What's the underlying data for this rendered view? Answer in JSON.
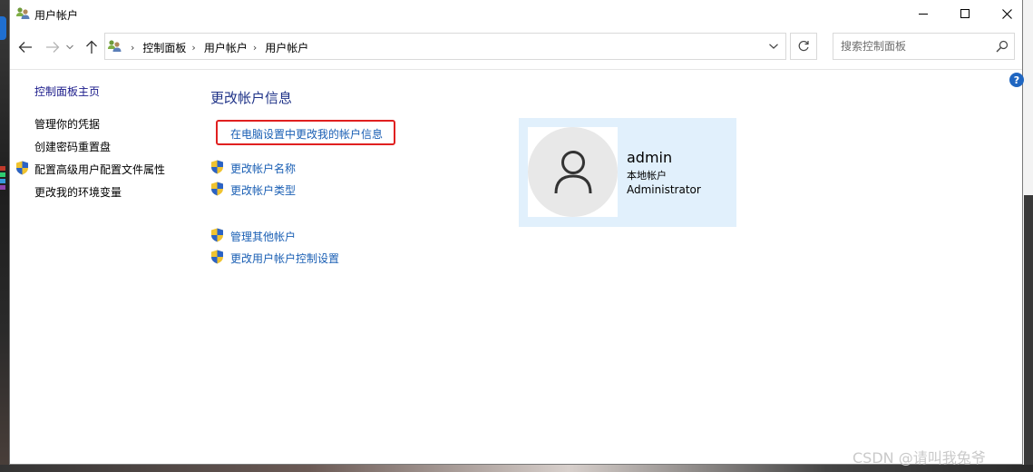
{
  "window": {
    "title": "用户帐户"
  },
  "address": {
    "crumbs": [
      "控制面板",
      "用户帐户",
      "用户帐户"
    ]
  },
  "search": {
    "placeholder": "搜索控制面板"
  },
  "help": {
    "label": "?"
  },
  "sidebar": {
    "home": "控制面板主页",
    "items": [
      {
        "label": "管理你的凭据",
        "shield": false
      },
      {
        "label": "创建密码重置盘",
        "shield": false
      },
      {
        "label": "配置高级用户配置文件属性",
        "shield": true
      },
      {
        "label": "更改我的环境变量",
        "shield": false
      }
    ]
  },
  "main": {
    "heading": "更改帐户信息",
    "pc_settings_link": "在电脑设置中更改我的帐户信息",
    "links": [
      {
        "label": "更改帐户名称",
        "shield": true
      },
      {
        "label": "更改帐户类型",
        "shield": true
      },
      {
        "label": "管理其他帐户",
        "shield": true
      },
      {
        "label": "更改用户帐户控制设置",
        "shield": true
      }
    ]
  },
  "account": {
    "name": "admin",
    "type": "本地帐户",
    "group": "Administrator"
  },
  "watermark": "CSDN @请叫我兔爷",
  "colors": {
    "link": "#1a5fb4",
    "heading": "#1e3287",
    "highlight": "#e02020",
    "card_bg": "#e1f0fc"
  },
  "icons": {
    "uac_shield": "uac-shield-icon",
    "user": "user-avatar-icon"
  }
}
